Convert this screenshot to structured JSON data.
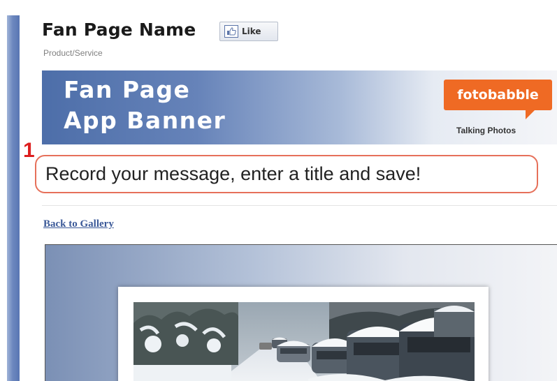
{
  "page": {
    "title": "Fan Page Name",
    "category": "Product/Service"
  },
  "like_button": {
    "label": "Like",
    "icon": "like-box-icon"
  },
  "banner": {
    "title_line1": "Fan Page",
    "title_line2": "App Banner",
    "brand": "fotobabble",
    "tagline": "Talking Photos"
  },
  "instruction": {
    "step": "1",
    "text": "Record your message, enter a title and save!"
  },
  "nav": {
    "back_link": "Back to Gallery"
  },
  "photo": {
    "scene": "snow-covered-street-with-cars"
  },
  "colors": {
    "brand_orange": "#ef6a24",
    "link_blue": "#3b5998",
    "highlight_red": "#dd1f1f",
    "outline_salmon": "#e6705a"
  }
}
